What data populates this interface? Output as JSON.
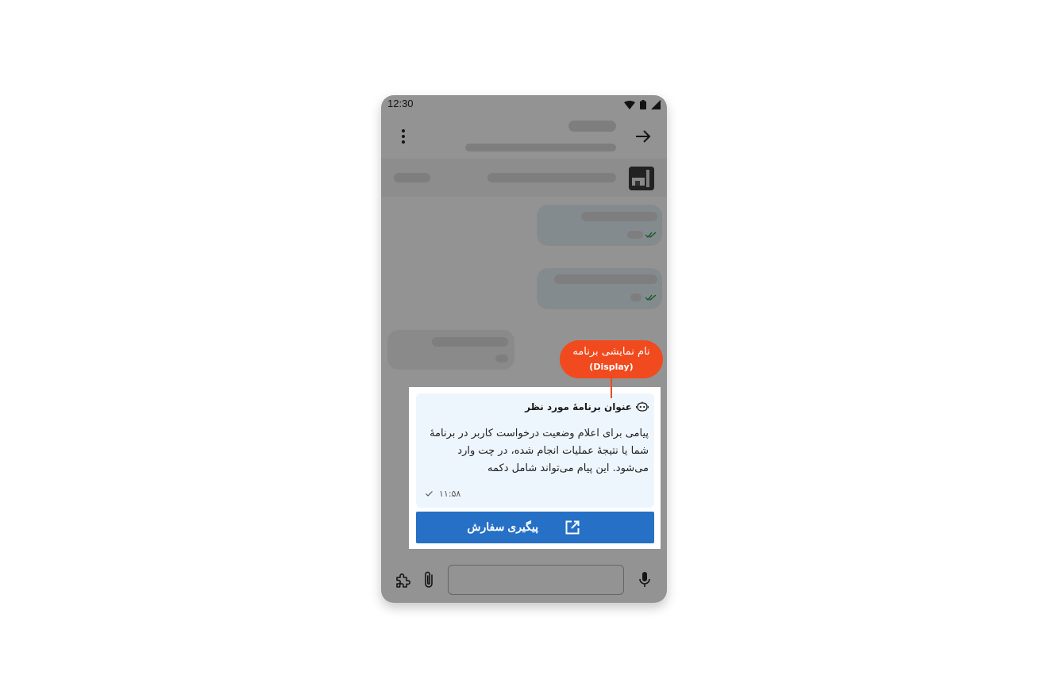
{
  "status_bar": {
    "time": "12:30"
  },
  "message_card": {
    "title": "عنوان برنامهٔ مورد نظر",
    "body": "پیامی برای اعلام وضعیت درخواست کاربر در برنامهٔ شما یا نتیجهٔ عملیات انجام شده، در چت وارد می‌شود. این پیام می‌تواند شامل دکمه",
    "time": "۱۱:۵۸",
    "action_button_label": "پیگیری سفارش"
  },
  "callout": {
    "line1": "نام نمایشی برنامه",
    "line2": "(Display)"
  },
  "colors": {
    "accent": "#2670c6",
    "callout": "#f04a1e",
    "card_background": "#eef6fd",
    "read_tick": "#1f8f3a"
  },
  "icons": [
    "more-vert-icon",
    "arrow-forward-icon",
    "wifi-icon",
    "battery-icon",
    "signal-icon",
    "double-check-icon",
    "robot-icon",
    "open-in-new-icon",
    "extension-icon",
    "attach-icon",
    "mic-icon",
    "check-icon"
  ]
}
